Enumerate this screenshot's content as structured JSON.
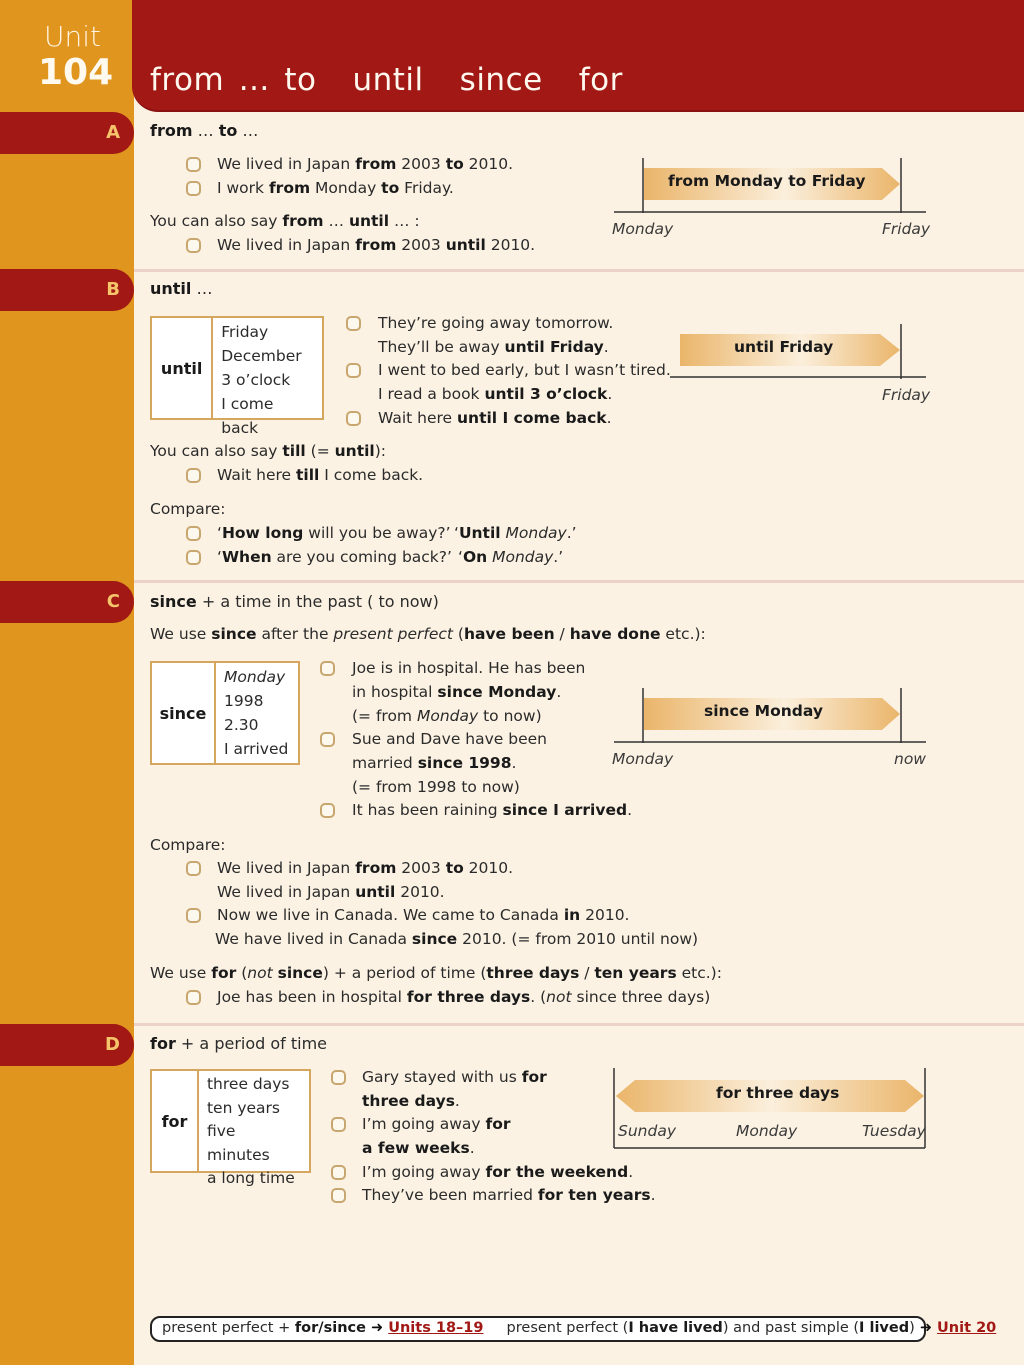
{
  "unit": {
    "label": "Unit",
    "number": "104"
  },
  "title_words": [
    "from … to",
    "until",
    "since",
    "for"
  ],
  "colors": {
    "header_red": "#a11815",
    "side_orange": "#e0951f",
    "page_bg": "#fbf2e3",
    "box_border": "#d5a65d",
    "link": "#a11815"
  },
  "sections": {
    "A": {
      "letter": "A",
      "heading": {
        "b1": "from",
        "t1": " … ",
        "b2": "to",
        "t2": " …"
      },
      "examples": [
        {
          "t1": "We lived in Japan ",
          "b1": "from",
          "t2": " 2003 ",
          "b2": "to",
          "t3": " 2010."
        },
        {
          "t1": "I work ",
          "b1": "from",
          "t2": " Monday ",
          "b2": "to",
          "t3": " Friday."
        }
      ],
      "also": {
        "t1": "You can also say ",
        "b1": "from",
        "t2": " … ",
        "b2": "until",
        "t3": " … :"
      },
      "also_example": {
        "t1": "We lived in Japan ",
        "b1": "from",
        "t2": " 2003 ",
        "b2": "until",
        "t3": " 2010."
      },
      "diagram": {
        "label": "from Monday to Friday",
        "start": "Monday",
        "end": "Friday"
      }
    },
    "B": {
      "letter": "B",
      "heading": {
        "b1": "until",
        "t1": " …"
      },
      "box": {
        "key": "until",
        "values": [
          "Friday",
          "December",
          "3 o’clock",
          "I come back"
        ]
      },
      "examples": [
        {
          "line1": "They’re going away tomorrow.",
          "l2t1": "They’ll be away ",
          "l2b1": "until Friday",
          "l2t2": "."
        },
        {
          "line1": "I went to bed early, but I wasn’t tired.",
          "l2t1": "I read a book ",
          "l2b1": "until 3 o’clock",
          "l2t2": "."
        },
        {
          "t1": "Wait here ",
          "b1": "until I come back",
          "t2": "."
        }
      ],
      "diagram": {
        "label": "until Friday",
        "end": "Friday"
      },
      "till": {
        "t1": "You can also say ",
        "b1": "till",
        "t2": " (= ",
        "b2": "until",
        "t3": "):"
      },
      "till_example": {
        "t1": "Wait here ",
        "b1": "till",
        "t2": " I come back."
      },
      "compare_label": "Compare:",
      "compare": [
        {
          "q1": "‘",
          "qb": "How long",
          "q2": " will you be away?’",
          "a1": "‘",
          "ab": "Until",
          "ai": " Monday",
          "a2": ".’"
        },
        {
          "q1": "‘",
          "qb": "When",
          "q2": " are you coming back?’",
          "a1": "‘",
          "ab": "On",
          "ai": " Monday",
          "a2": ".’"
        }
      ]
    },
    "C": {
      "letter": "C",
      "heading": {
        "b1": "since",
        "t1": " + a time in the past ( to now)"
      },
      "intro": {
        "t1": "We use ",
        "b1": "since",
        "t2": " after the ",
        "i1": "present perfect",
        "t3": " (",
        "b2": "have been",
        "t4": " / ",
        "b3": "have done",
        "t5": " etc.):"
      },
      "box": {
        "key": "since",
        "values": [
          "Monday",
          "1998",
          "2.30",
          "I arrived"
        ]
      },
      "examples": [
        {
          "l1": "Joe is in hospital.  He has been",
          "l2t1": "in hospital ",
          "l2b1": "since Monday",
          "l2t2": ".",
          "l3t1": "(= from ",
          "l3i1": "Monday",
          "l3t2": " to now)"
        },
        {
          "l1": "Sue and Dave have been",
          "l2t1": "married ",
          "l2b1": "since 1998",
          "l2t2": ".",
          "l3": "(= from 1998 to now)"
        },
        {
          "t1": "It has been raining ",
          "b1": "since I arrived",
          "t2": "."
        }
      ],
      "diagram": {
        "label": "since Monday",
        "start": "Monday",
        "end": "now"
      },
      "compare_label": "Compare:",
      "compare": [
        {
          "l1t1": "We lived in Japan ",
          "l1b1": "from",
          "l1t2": " 2003 ",
          "l1b2": "to",
          "l1t3": " 2010.",
          "l2t1": "We lived in Japan ",
          "l2b1": "until",
          "l2t2": " 2010."
        },
        {
          "l1t1": "Now we live in Canada.  We came to Canada ",
          "l1b1": "in",
          "l1t2": " 2010.",
          "l2t1": "We have lived in Canada ",
          "l2b1": "since",
          "l2t2": " 2010.   (= from 2010 until now)"
        }
      ],
      "for_note": {
        "t1": "We use ",
        "b1": "for",
        "t2": " (",
        "i1": "not",
        "t3": " ",
        "b2": "since",
        "t4": ") + a period of time (",
        "b3": "three days",
        "t5": " / ",
        "b4": "ten years",
        "t6": " etc.):"
      },
      "for_example": {
        "t1": "Joe has been in hospital ",
        "b1": "for three days",
        "t2": ".   (",
        "i1": "not",
        "t3": " since three days)"
      }
    },
    "D": {
      "letter": "D",
      "heading": {
        "b1": "for",
        "t1": " + a period of time"
      },
      "box": {
        "key": "for",
        "values": [
          "three days",
          "ten years",
          "five minutes",
          "a long time"
        ]
      },
      "examples": [
        {
          "l1t1": "Gary stayed with us ",
          "l1b1": "for",
          "l2b1": "three days",
          "l2t1": "."
        },
        {
          "l1t1": "I’m going away ",
          "l1b1": "for",
          "l2b1": "a few weeks",
          "l2t1": "."
        },
        {
          "t1": "I’m going away ",
          "b1": "for the weekend",
          "t2": "."
        },
        {
          "t1": "They’ve been married ",
          "b1": "for ten years",
          "t2": "."
        }
      ],
      "diagram": {
        "label": "for three days",
        "ticks": [
          "Sunday",
          "Monday",
          "Tuesday"
        ]
      }
    }
  },
  "footer": {
    "t1": "present perfect + ",
    "b1": "for/since",
    "arrow": " ➜ ",
    "link1": "Units 18–19",
    "t2": "present perfect (",
    "b2": "I have lived",
    "t3": ") and past simple (",
    "b3": "I lived",
    "t4": ")",
    "link2": "Unit 20"
  }
}
